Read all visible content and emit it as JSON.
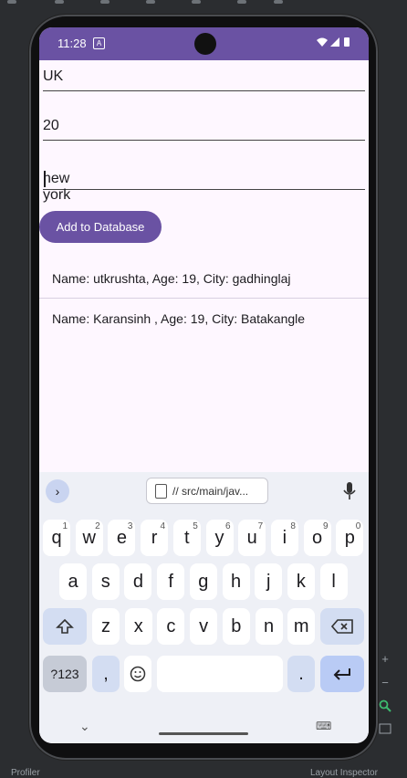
{
  "ide": {
    "bottom_left": "Profiler",
    "bottom_right": "Layout Inspector"
  },
  "status": {
    "time": "11:28",
    "badge": "A"
  },
  "form": {
    "field1_value": "UK",
    "field2_value": "20",
    "field3_value": "new york",
    "add_button_label": "Add to Database"
  },
  "list": [
    {
      "text": "Name: utkrushta, Age: 19, City: gadhinglaj"
    },
    {
      "text": "Name: Karansinh , Age: 19, City: Batakangle"
    }
  ],
  "keyboard": {
    "clipboard_text": "// src/main/jav...",
    "row1": [
      {
        "k": "q",
        "n": "1"
      },
      {
        "k": "w",
        "n": "2"
      },
      {
        "k": "e",
        "n": "3"
      },
      {
        "k": "r",
        "n": "4"
      },
      {
        "k": "t",
        "n": "5"
      },
      {
        "k": "y",
        "n": "6"
      },
      {
        "k": "u",
        "n": "7"
      },
      {
        "k": "i",
        "n": "8"
      },
      {
        "k": "o",
        "n": "9"
      },
      {
        "k": "p",
        "n": "0"
      }
    ],
    "row2": [
      "a",
      "s",
      "d",
      "f",
      "g",
      "h",
      "j",
      "k",
      "l"
    ],
    "row3": [
      "z",
      "x",
      "c",
      "v",
      "b",
      "n",
      "m"
    ],
    "sym_label": "?123",
    "comma": ",",
    "period": "."
  }
}
